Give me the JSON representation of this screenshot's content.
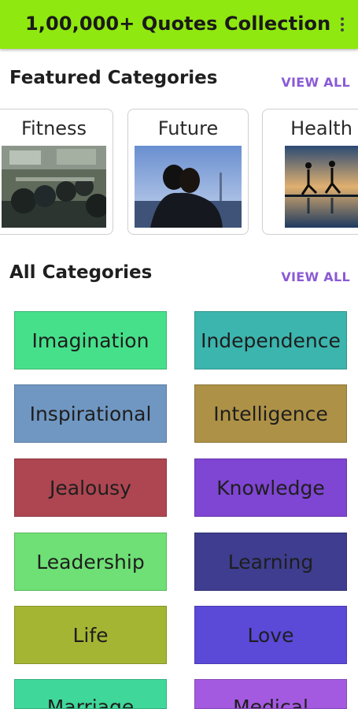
{
  "appbar": {
    "title": "1,00,000+ Quotes Collection",
    "menu_icon": "more-vert-icon"
  },
  "featured": {
    "title": "Featured Categories",
    "view_all": "VIEW ALL",
    "cards": [
      {
        "label": "Fitness"
      },
      {
        "label": "Future"
      },
      {
        "label": "Health"
      }
    ]
  },
  "all": {
    "title": "All Categories",
    "view_all": "VIEW ALL",
    "items": [
      {
        "label": "Imagination",
        "color": "#46e08a"
      },
      {
        "label": "Independence",
        "color": "#3bb5ae"
      },
      {
        "label": "Inspirational",
        "color": "#7097c2"
      },
      {
        "label": "Intelligence",
        "color": "#ad9146"
      },
      {
        "label": "Jealousy",
        "color": "#ad4651"
      },
      {
        "label": "Knowledge",
        "color": "#7f45d3"
      },
      {
        "label": "Leadership",
        "color": "#6fe075"
      },
      {
        "label": "Learning",
        "color": "#3e3d8f"
      },
      {
        "label": "Life",
        "color": "#a4b533"
      },
      {
        "label": "Love",
        "color": "#5b49d8"
      },
      {
        "label": "Marriage",
        "color": "#40d89a"
      },
      {
        "label": "Medical",
        "color": "#a45ae0"
      }
    ]
  }
}
